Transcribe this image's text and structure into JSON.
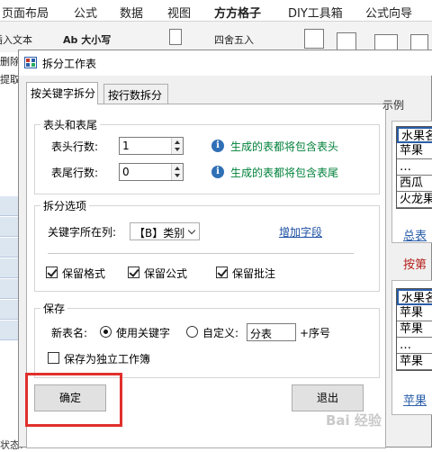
{
  "ribbon": {
    "tabs": [
      "页面布局",
      "公式",
      "数据",
      "视图",
      "方方格子",
      "DIY工具箱",
      "公式向导"
    ],
    "active_tab": "方方格子",
    "tools": {
      "insert_text": "插入文本",
      "font_size": "Ab 大小写",
      "round": "四舍五入",
      "delete": "删除",
      "extract": "提取"
    }
  },
  "status_bar": {
    "text": "状态:"
  },
  "dialog": {
    "title": "拆分工作表",
    "tabs": [
      "按关键字拆分",
      "按行数拆分"
    ],
    "header_footer": {
      "legend": "表头和表尾",
      "header_rows_label": "表头行数:",
      "header_rows_value": "1",
      "header_hint": "生成的表都将包含表头",
      "footer_rows_label": "表尾行数:",
      "footer_rows_value": "0",
      "footer_hint": "生成的表都将包含表尾"
    },
    "split_options": {
      "legend": "拆分选项",
      "key_column_label": "关键字所在列:",
      "key_column_value": "【B】类别",
      "add_field_link": "增加字段",
      "keep_format": "保留格式",
      "keep_formula": "保留公式",
      "keep_comment": "保留批注"
    },
    "save": {
      "legend": "保存",
      "new_name_label": "新表名:",
      "use_keyword": "使用关键字",
      "custom": "自定义:",
      "custom_value": "分表",
      "suffix": "+序号",
      "save_separate": "保存为独立工作簿"
    },
    "ok_button": "确定",
    "exit_button": "退出",
    "example": {
      "label": "示例",
      "top_table": [
        "水果名",
        "苹果",
        "…",
        "西瓜",
        "火龙果"
      ],
      "top_tab": "总表",
      "split_text": "按第",
      "bottom_table": [
        "水果名",
        "苹果",
        "苹果",
        "…",
        "苹果"
      ],
      "bottom_tab": "苹果"
    }
  },
  "watermark": "Bai 经验"
}
